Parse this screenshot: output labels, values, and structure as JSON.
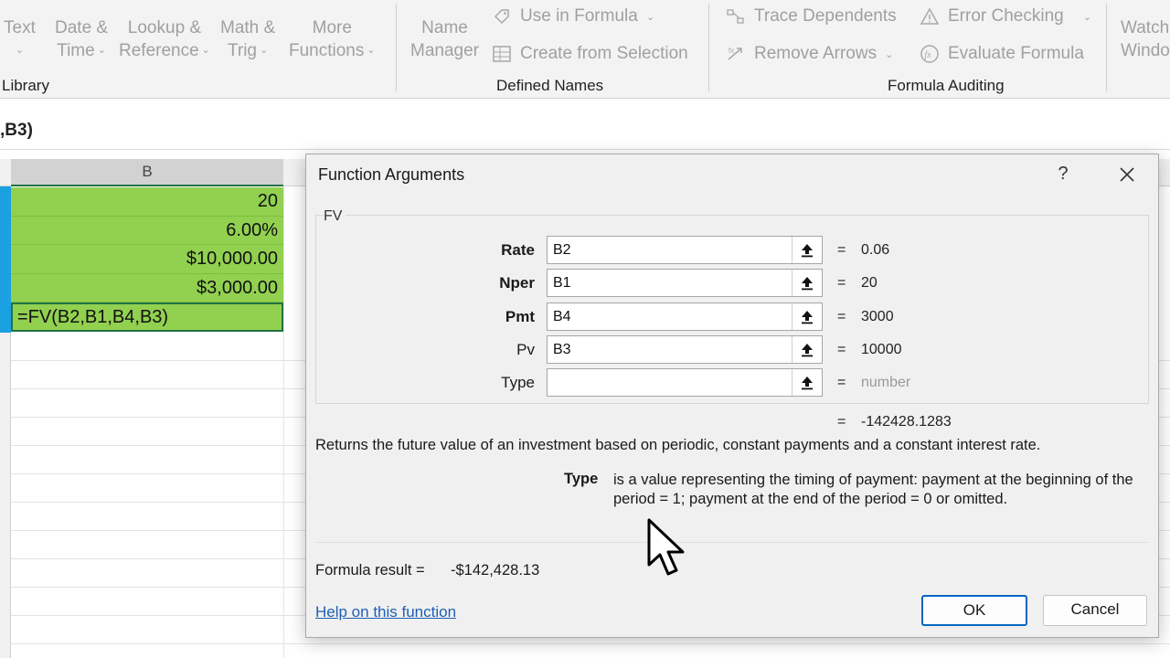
{
  "ribbon": {
    "text_label": "Text",
    "datetime_label_1": "Date &",
    "datetime_label_2": "Time",
    "lookup_label_1": "Lookup &",
    "lookup_label_2": "Reference",
    "math_label_1": "Math &",
    "math_label_2": "Trig",
    "more_label_1": "More",
    "more_label_2": "Functions",
    "name_manager_1": "Name",
    "name_manager_2": "Manager",
    "use_in_formula": "Use in Formula",
    "create_from_selection": "Create from Selection",
    "trace_dependents": "Trace Dependents",
    "remove_arrows": "Remove Arrows",
    "error_checking": "Error Checking",
    "evaluate_formula": "Evaluate Formula",
    "watch_1": "Watch",
    "watch_2": "Window",
    "groups": {
      "library": "Library",
      "defined_names": "Defined Names",
      "formula_auditing": "Formula Auditing"
    }
  },
  "formula_bar": {
    "text": ",B3)"
  },
  "sheet": {
    "column_header": "B",
    "cells": [
      "20",
      "6.00%",
      "$10,000.00",
      "$3,000.00",
      "=FV(B2,B1,B4,B3)"
    ]
  },
  "dialog": {
    "title": "Function Arguments",
    "help_glyph": "?",
    "function_name": "FV",
    "args": [
      {
        "label": "Rate",
        "value": "B2",
        "result": "0.06"
      },
      {
        "label": "Nper",
        "value": "B1",
        "result": "20"
      },
      {
        "label": "Pmt",
        "value": "B4",
        "result": "3000"
      },
      {
        "label": "Pv",
        "value": "B3",
        "result": "10000"
      },
      {
        "label": "Type",
        "value": "",
        "result": "number"
      }
    ],
    "equals": "=",
    "total_result": "-142428.1283",
    "description": "Returns the future value of an investment based on periodic, constant payments and a constant interest rate.",
    "param_name": "Type",
    "param_description": "is a value representing the timing of payment: payment at the beginning of the period = 1; payment at the end of the period = 0 or omitted.",
    "formula_result_label": "Formula result =",
    "formula_result_value": "-$142,428.13",
    "help_link": "Help on this function",
    "ok_label": "OK",
    "cancel_label": "Cancel"
  },
  "colors": {
    "cell_fill": "#92d050",
    "selection_accent": "#217346",
    "row_selection": "#1ba1e2",
    "link": "#1e5fb4",
    "ok_border": "#0067c0"
  }
}
